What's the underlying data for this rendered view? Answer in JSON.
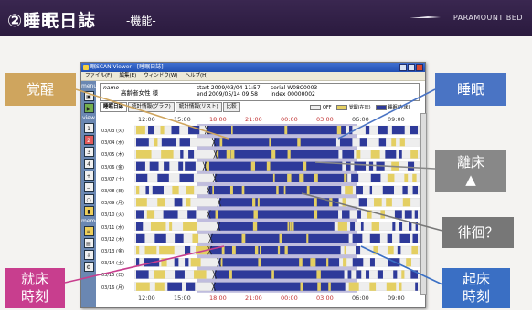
{
  "header": {
    "title": "②睡眠日誌",
    "subtitle": "-機能-",
    "brand": "PARAMOUNT BED"
  },
  "window": {
    "title": "眠SCAN Viewer - [睡眠日誌]",
    "menu": [
      "ファイル(F)",
      "編集(E)",
      "ウィンドウ(W)",
      "ヘルプ(H)"
    ]
  },
  "toolbar": {
    "menu_label": "menu",
    "view_label": "view",
    "memo_label": "memo",
    "buttons": [
      "1",
      "2",
      "3",
      "4"
    ]
  },
  "info": {
    "name_label": "name",
    "name": "高齢者女性 様",
    "start": "start 2009/03/04 11:57",
    "end": "end  2009/05/14 09:58",
    "serial": "serial W08C0003",
    "index": "index 00000002"
  },
  "tabs": [
    "睡眠日誌",
    "統計情報(グラフ)",
    "統計情報(リスト)",
    "比較"
  ],
  "legend": {
    "off": "OFF",
    "awake": "覚醒(在床)",
    "sleep": "睡眠(在床)"
  },
  "chart_data": {
    "type": "heatmap",
    "time_labels": [
      "12:00",
      "15:00",
      "18:00",
      "21:00",
      "00:00",
      "03:00",
      "06:00",
      "09:00"
    ],
    "dates": [
      "03/03 (火)",
      "03/04 (水)",
      "03/05 (木)",
      "03/06 (金)",
      "03/07 (土)",
      "03/08 (日)",
      "03/09 (月)",
      "03/10 (火)",
      "03/11 (水)",
      "03/12 (木)",
      "03/13 (金)",
      "03/14 (土)",
      "03/15 (日)",
      "03/16 (月)"
    ],
    "colors": {
      "off": "#eeeeee",
      "awake": "#e4cf62",
      "sleep": "#2e3a9a",
      "night": "#8d86c2"
    }
  },
  "callouts": {
    "kakusei": "覚醒",
    "suimin": "睡眠",
    "rishou": [
      "離床",
      "▲"
    ],
    "haikai": "徘徊？",
    "shushou": [
      "就床",
      "時刻"
    ],
    "kishou": [
      "起床",
      "時刻"
    ]
  }
}
